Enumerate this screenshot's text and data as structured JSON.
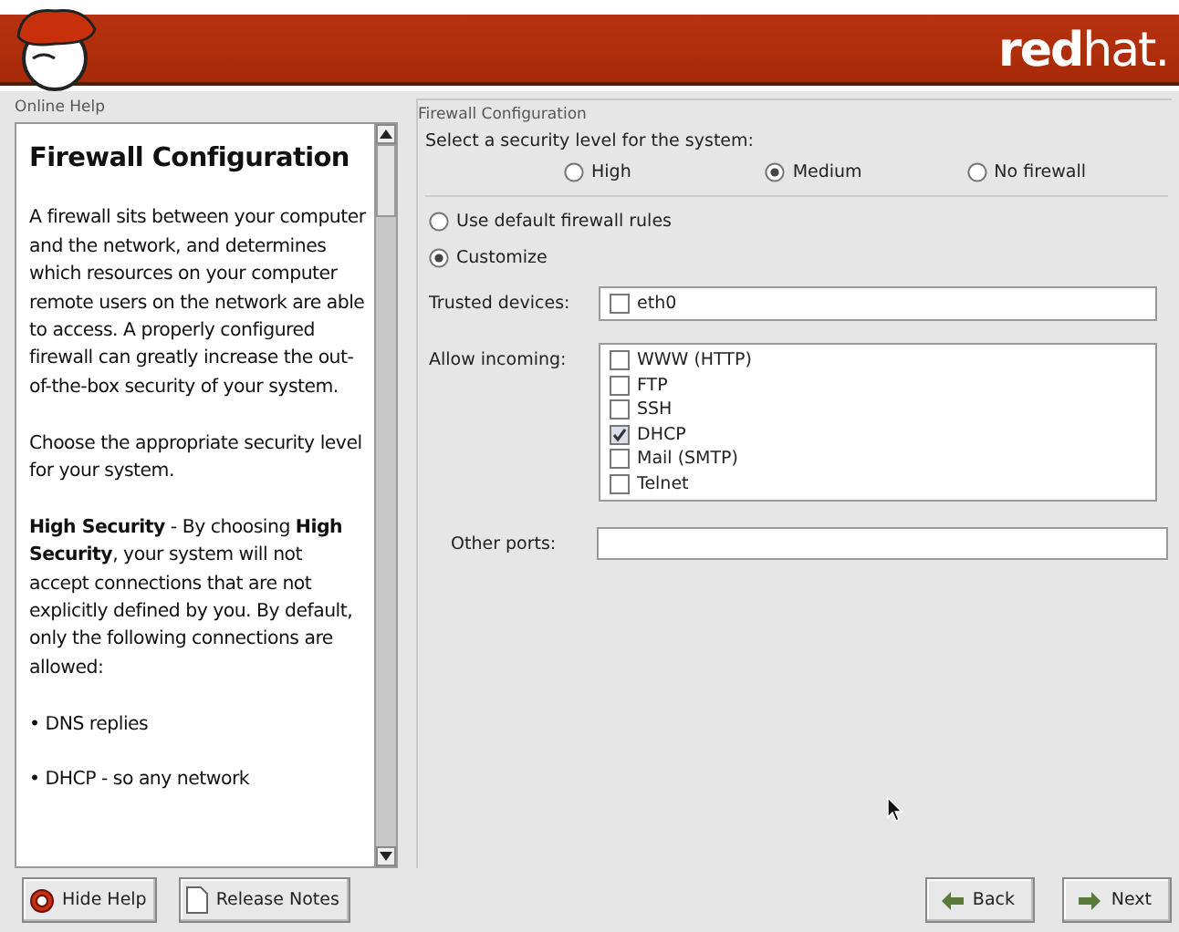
{
  "header": {
    "logo_text": "**red**hat."
  },
  "help": {
    "title": "Online Help",
    "heading": "Firewall Configuration",
    "paragraphs": [
      "A firewall sits between your computer and the network, and determines which resources on your computer remote users on the network are able to access. A properly configured firewall can greatly increase the out-of-the-box security of your system.",
      "Choose the appropriate security level for your system.",
      "**High Security** - By choosing **High Security**, your system will not accept connections that are not explicitly defined by you. By default, only the following connections are allowed:",
      "• DNS replies",
      "• DHCP - so any network"
    ]
  },
  "config": {
    "title": "Firewall Configuration",
    "prompt": "Select a security level for the system:",
    "levels": [
      {
        "label": "High",
        "selected": false
      },
      {
        "label": "Medium",
        "selected": true
      },
      {
        "label": "No firewall",
        "selected": false
      }
    ],
    "rules": [
      {
        "label": "Use default firewall rules",
        "selected": false
      },
      {
        "label": "Customize",
        "selected": true
      }
    ],
    "trusted": {
      "label": "Trusted devices:",
      "items": [
        {
          "label": "eth0",
          "checked": false
        }
      ]
    },
    "incoming": {
      "label": "Allow incoming:",
      "items": [
        {
          "label": "WWW (HTTP)",
          "checked": false
        },
        {
          "label": "FTP",
          "checked": false
        },
        {
          "label": "SSH",
          "checked": false
        },
        {
          "label": "DHCP",
          "checked": true
        },
        {
          "label": "Mail (SMTP)",
          "checked": false
        },
        {
          "label": "Telnet",
          "checked": false
        }
      ]
    },
    "other_ports": {
      "label": "Other ports:"
    }
  },
  "buttons": {
    "left": [
      {
        "label": "Hide Help",
        "kind": "help"
      },
      {
        "label": "Release Notes",
        "kind": "notes"
      }
    ],
    "right": [
      {
        "label": "Back",
        "kind": "back"
      },
      {
        "label": "Next",
        "kind": "next"
      }
    ]
  }
}
